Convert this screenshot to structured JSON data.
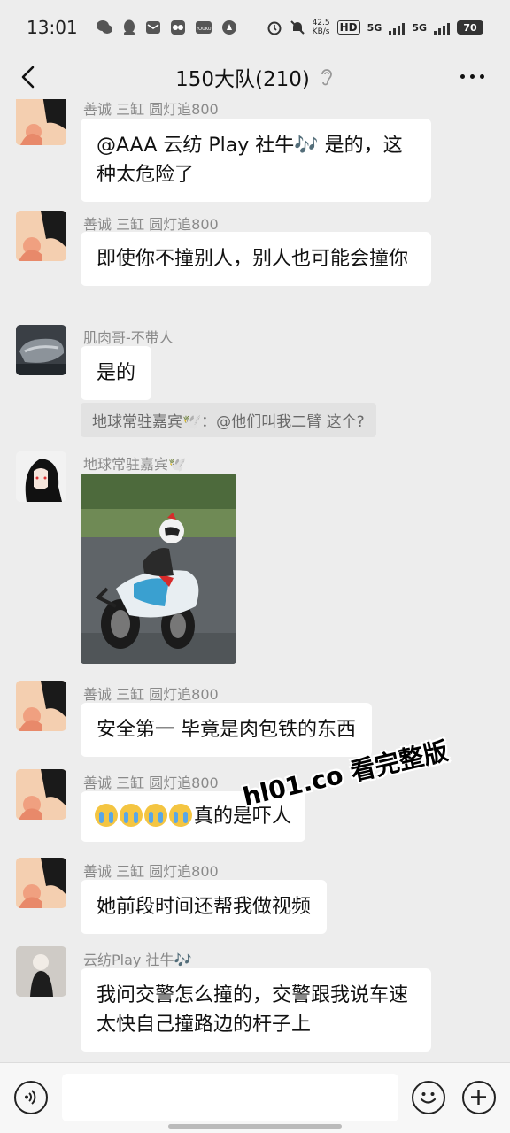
{
  "status": {
    "time": "13:01",
    "net_speed_value": "42.5",
    "net_speed_unit": "KB/s",
    "hd": "HD",
    "sig1": "5G",
    "sig2": "5G",
    "battery": "70"
  },
  "header": {
    "title": "150大队(210)"
  },
  "messages": [
    {
      "nick": "善诚 三缸 圆灯追800",
      "text": "@AAA 云纺 Play 社牛🎶  是的，这种太危险了"
    },
    {
      "nick": "善诚 三缸 圆灯追800",
      "text": "即使你不撞别人，别人也可能会撞你"
    },
    {
      "nick": "肌肉哥-不带人",
      "text": "是的",
      "quote": "地球常驻嘉宾🕊️：@他们叫我二臂 这个?"
    },
    {
      "nick": "地球常驻嘉宾🕊️"
    },
    {
      "nick": "善诚 三缸 圆灯追800",
      "text": "安全第一 毕竟是肉包铁的东西"
    },
    {
      "nick": "善诚 三缸 圆灯追800",
      "text": "真的是吓人"
    },
    {
      "nick": "善诚 三缸 圆灯追800",
      "text": "她前段时间还帮我做视频"
    },
    {
      "nick": "云纺Play 社牛🎶",
      "text": "我问交警怎么撞的，交警跟我说车速太快自己撞路边的杆子上"
    }
  ],
  "watermark": "hl01.co 看完整版",
  "icons": {
    "back": "chevron-left-icon",
    "mute": "ear-icon",
    "more": "more-dots-icon",
    "voice": "voice-icon",
    "emoji": "smile-icon",
    "plus": "plus-icon"
  }
}
